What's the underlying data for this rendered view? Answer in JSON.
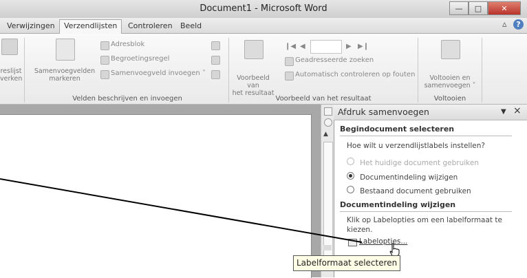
{
  "window": {
    "title": "Document1 - Microsoft Word",
    "minimize": "—",
    "maximize": "□",
    "close": "✕"
  },
  "tabs": [
    {
      "label": "Verwijzingen"
    },
    {
      "label": "Verzendlijsten"
    },
    {
      "label": "Controleren"
    },
    {
      "label": "Beeld"
    }
  ],
  "tabrow_right": {
    "expand": "▵",
    "help": "?"
  },
  "ribbon": {
    "left_partial": [
      "reslijst",
      "verken"
    ],
    "samenvoegvelden": [
      "Samenvoegvelden",
      "markeren"
    ],
    "adresblok": "Adresblok",
    "begroetingsregel": "Begroetingsregel",
    "samenvoegveld_invoegen": "Samenvoegveld invoegen ˅",
    "group1_label": "Velden beschrijven en invoegen",
    "voorbeeld": [
      "Voorbeeld van",
      "het resultaat"
    ],
    "nav_first": "❙◀",
    "nav_prev": "◀",
    "nav_next": "▶",
    "nav_last": "▶❙",
    "geadresseerde": "Geadresseerde zoeken",
    "controleren": "Automatisch controleren op fouten",
    "group2_label": "Voorbeeld van het resultaat",
    "voltooien": [
      "Voltooien en",
      "samenvoegen ˅"
    ],
    "group3_label": "Voltooien"
  },
  "taskpane": {
    "title": "Afdruk samenvoegen",
    "dropdown": "▼",
    "close": "×",
    "section1": "Begindocument selecteren",
    "question": "Hoe wilt u verzendlijstlabels instellen?",
    "options": [
      {
        "label": "Het huidige document gebruiken",
        "checked": false,
        "disabled": true
      },
      {
        "label": "Documentindeling wijzigen",
        "checked": true,
        "disabled": false
      },
      {
        "label": "Bestaand document gebruiken",
        "checked": false,
        "disabled": false
      }
    ],
    "section2": "Documentindeling wijzigen",
    "instruction_line1": "Klik op Labelopties om een labelformaat te",
    "instruction_line2": "kiezen.",
    "labelopties": "Labelopties..."
  },
  "tooltip": "Labelformaat selecteren",
  "colors": {
    "accent_tab": "#f7f7f7",
    "close_button": "#c0392b",
    "tooltip_bg": "#ffffe8"
  }
}
